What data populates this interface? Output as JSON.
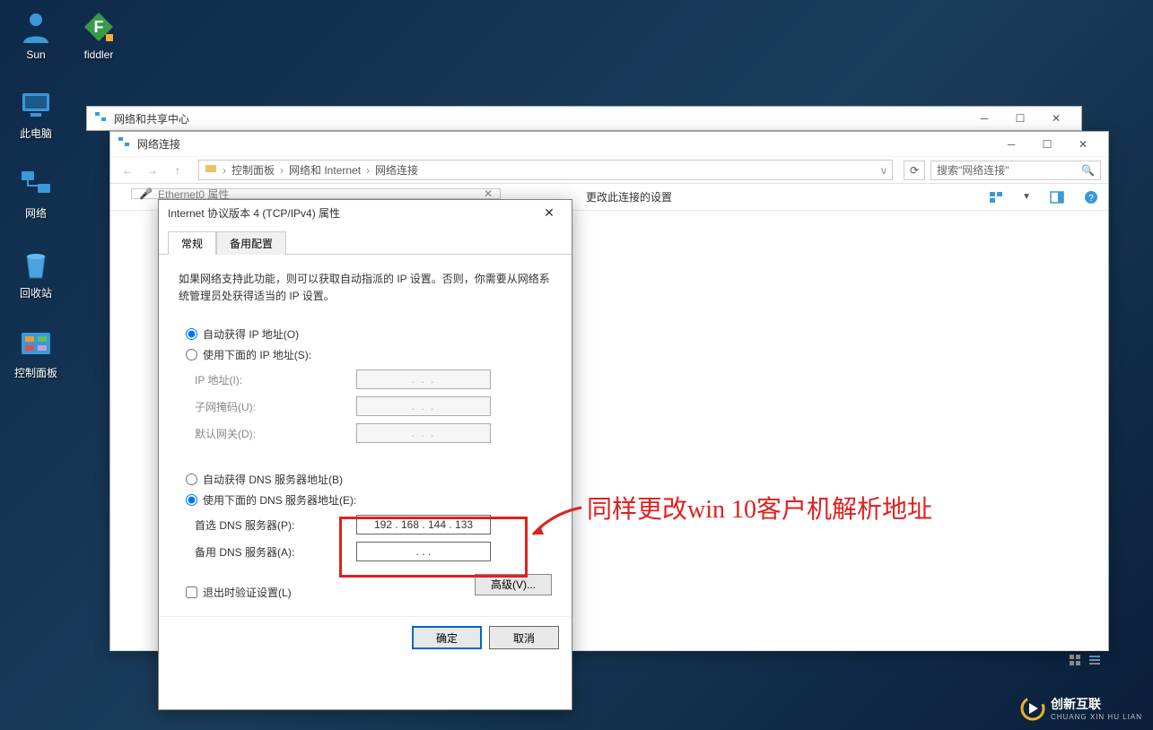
{
  "desktop": {
    "icons": [
      {
        "name": "Sun"
      },
      {
        "name": "此电脑"
      },
      {
        "name": "网络"
      },
      {
        "name": "回收站"
      },
      {
        "name": "控制面板"
      }
    ],
    "icon_fiddler": "fiddler"
  },
  "win_share": {
    "title": "网络和共享中心"
  },
  "win_net": {
    "title": "网络连接",
    "breadcrumbs": [
      "控制面板",
      "网络和 Internet",
      "网络连接"
    ],
    "breadcrumb_sep": "›",
    "search_placeholder": "搜索\"网络连接\"",
    "toolbar_item": "更改此连接的设置"
  },
  "win_eth": {
    "title": "Ethernet0 属性"
  },
  "ip4": {
    "title": "Internet 协议版本 4 (TCP/IPv4) 属性",
    "tab_general": "常规",
    "tab_alt": "备用配置",
    "description": "如果网络支持此功能，则可以获取自动指派的 IP 设置。否则，你需要从网络系统管理员处获得适当的 IP 设置。",
    "radio_auto_ip": "自动获得 IP 地址(O)",
    "radio_manual_ip": "使用下面的 IP 地址(S):",
    "label_ip": "IP 地址(I):",
    "label_mask": "子网掩码(U):",
    "label_gw": "默认网关(D):",
    "radio_auto_dns": "自动获得 DNS 服务器地址(B)",
    "radio_manual_dns": "使用下面的 DNS 服务器地址(E):",
    "label_dns1": "首选 DNS 服务器(P):",
    "label_dns2": "备用 DNS 服务器(A):",
    "dns1_value": "192 . 168 . 144 . 133",
    "empty_ip": ".       .       .",
    "chk_validate": "退出时验证设置(L)",
    "btn_advanced": "高级(V)...",
    "btn_ok": "确定",
    "btn_cancel": "取消"
  },
  "annotation": {
    "text": "同样更改win 10客户机解析地址"
  },
  "watermark": {
    "brand": "创新互联",
    "sub": "CHUANG XIN HU LIAN"
  }
}
